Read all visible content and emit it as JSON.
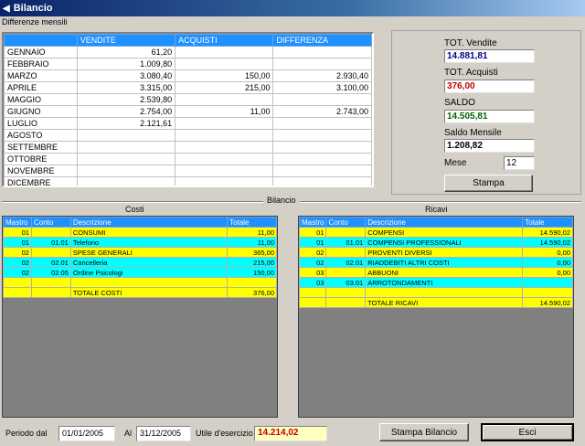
{
  "window": {
    "title": "Bilancio"
  },
  "monthly": {
    "section_label": "Differenze mensili",
    "columns": [
      "",
      "VENDITE",
      "ACQUISTI",
      "DIFFERENZA"
    ],
    "rows": [
      [
        "GENNAIO",
        "61,20",
        "",
        ""
      ],
      [
        "FEBBRAIO",
        "1.009,80",
        "",
        ""
      ],
      [
        "MARZO",
        "3.080,40",
        "150,00",
        "2.930,40"
      ],
      [
        "APRILE",
        "3.315,00",
        "215,00",
        "3.100,00"
      ],
      [
        "MAGGIO",
        "2.539,80",
        "",
        ""
      ],
      [
        "GIUGNO",
        "2.754,00",
        "11,00",
        "2.743,00"
      ],
      [
        "LUGLIO",
        "2.121,61",
        "",
        ""
      ],
      [
        "AGOSTO",
        "",
        "",
        ""
      ],
      [
        "SETTEMBRE",
        "",
        "",
        ""
      ],
      [
        "OTTOBRE",
        "",
        "",
        ""
      ],
      [
        "NOVEMBRE",
        "",
        "",
        ""
      ],
      [
        "DICEMBRE",
        "",
        "",
        ""
      ]
    ]
  },
  "totals": {
    "vendite_label": "TOT. Vendite",
    "vendite_value": "14.881,81",
    "acquisti_label": "TOT. Acquisti",
    "acquisti_value": "376,00",
    "saldo_label": "SALDO",
    "saldo_value": "14.505,81",
    "saldo_mensile_label": "Saldo Mensile",
    "saldo_mensile_value": "1.208,82",
    "mese_label": "Mese",
    "mese_value": "12",
    "stampa_label": "Stampa"
  },
  "bilancio": {
    "label": "Bilancio",
    "costi_label": "Costi",
    "ricavi_label": "Ricavi",
    "columns": [
      "Mastro",
      "Conto",
      "Descrizione",
      "Totale"
    ],
    "costi_rows": [
      {
        "mastro": "01",
        "conto": "",
        "desc": "CONSUMI",
        "totale": "11,00",
        "color": "yellow"
      },
      {
        "mastro": "01",
        "conto": "01.01",
        "desc": "Telefono",
        "totale": "11,00",
        "color": "cyan"
      },
      {
        "mastro": "02",
        "conto": "",
        "desc": "SPESE GENERALI",
        "totale": "365,00",
        "color": "yellow"
      },
      {
        "mastro": "02",
        "conto": "02.01",
        "desc": "Cancelleria",
        "totale": "215,00",
        "color": "cyan"
      },
      {
        "mastro": "02",
        "conto": "02.05",
        "desc": "Ordine Psicologi",
        "totale": "150,00",
        "color": "cyan"
      },
      {
        "mastro": "",
        "conto": "",
        "desc": "",
        "totale": "",
        "color": "yellow"
      },
      {
        "mastro": "",
        "conto": "",
        "desc": "TOTALE COSTI",
        "totale": "376,00",
        "color": "yellow"
      }
    ],
    "ricavi_rows": [
      {
        "mastro": "01",
        "conto": "",
        "desc": "COMPENSI",
        "totale": "14.590,02",
        "color": "yellow"
      },
      {
        "mastro": "01",
        "conto": "01.01",
        "desc": "COMPENSI PROFESSIONALI",
        "totale": "14.590,02",
        "color": "cyan"
      },
      {
        "mastro": "02",
        "conto": "",
        "desc": "PROVENTI DIVERSI",
        "totale": "0,00",
        "color": "yellow"
      },
      {
        "mastro": "02",
        "conto": "02.01",
        "desc": "RIADDEBITI ALTRI COSTI",
        "totale": "0,00",
        "color": "cyan"
      },
      {
        "mastro": "03",
        "conto": "",
        "desc": "ABBUONI",
        "totale": "0,00",
        "color": "yellow"
      },
      {
        "mastro": "03",
        "conto": "03.01",
        "desc": "ARROTONDAMENTI",
        "totale": "",
        "color": "cyan"
      },
      {
        "mastro": "",
        "conto": "",
        "desc": "",
        "totale": "",
        "color": "yellow"
      },
      {
        "mastro": "",
        "conto": "",
        "desc": "TOTALE RICAVI",
        "totale": "14.590,02",
        "color": "yellow"
      }
    ]
  },
  "footer": {
    "periodo_label": "Periodo dal",
    "dal_value": "01/01/2005",
    "al_label": "Al",
    "al_value": "31/12/2005",
    "utile_label": "Utile d'esercizio",
    "utile_value": "14.214,02",
    "stampa_bilancio_label": "Stampa Bilancio",
    "esci_label": "Esci"
  },
  "colors": {
    "header_blue": "#1e90ff",
    "grid_bg": "#2e8b8b",
    "yellow_row": "#ffff00",
    "cyan_row": "#00ffff",
    "vendite_text": "#00008b",
    "acquisti_text": "#c00000",
    "saldo_text": "#006400",
    "utile_text": "#c00000"
  }
}
